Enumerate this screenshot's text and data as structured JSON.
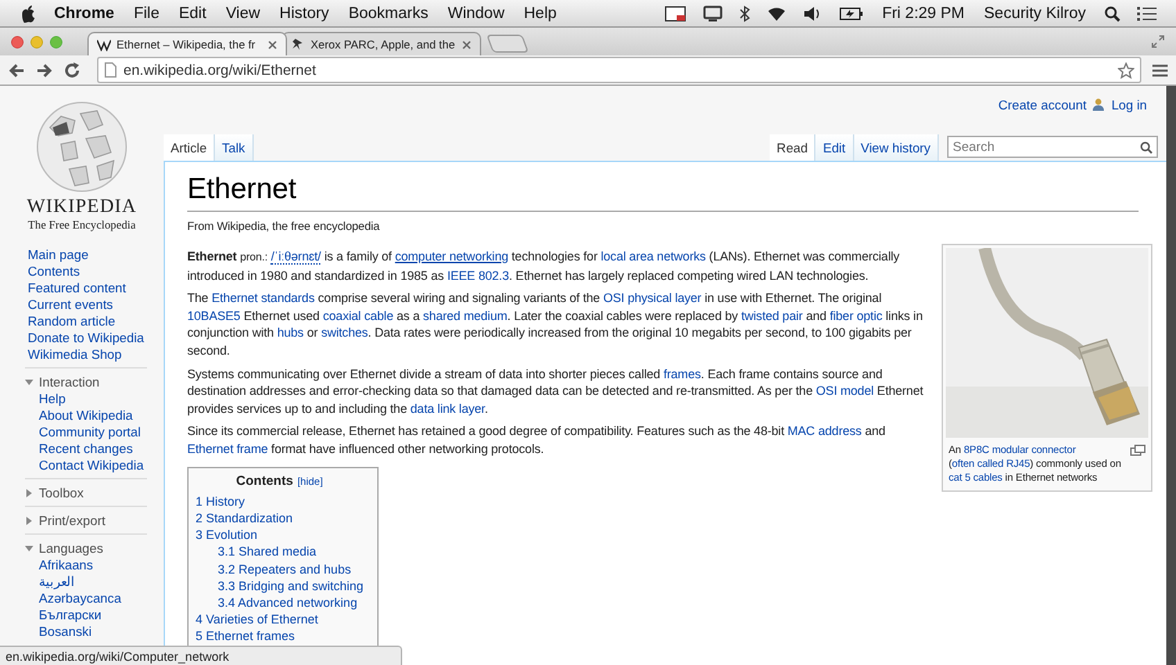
{
  "menubar": {
    "app": "Chrome",
    "menus": [
      "File",
      "Edit",
      "View",
      "History",
      "Bookmarks",
      "Window",
      "Help"
    ],
    "clock": "Fri 2:29 PM",
    "user": "Security Kilroy"
  },
  "browser": {
    "tabs": [
      {
        "title": "Ethernet – Wikipedia, the fr",
        "selected": true
      },
      {
        "title": "Xerox PARC, Apple, and the",
        "selected": false
      }
    ],
    "address": "en.wikipedia.org/wiki/Ethernet"
  },
  "wiki": {
    "logo": {
      "wordmark": "WIKIPEDIA",
      "tagline": "The Free Encyclopedia"
    },
    "nav": [
      "Main page",
      "Contents",
      "Featured content",
      "Current events",
      "Random article",
      "Donate to Wikipedia",
      "Wikimedia Shop"
    ],
    "portlets": [
      {
        "title": "Interaction",
        "expanded": true,
        "items": [
          "Help",
          "About Wikipedia",
          "Community portal",
          "Recent changes",
          "Contact Wikipedia"
        ]
      },
      {
        "title": "Toolbox",
        "expanded": false
      },
      {
        "title": "Print/export",
        "expanded": false
      },
      {
        "title": "Languages",
        "expanded": true,
        "items": [
          "Afrikaans",
          "العربية",
          "Azərbaycanca",
          "Български",
          "Bosanski"
        ]
      }
    ],
    "personal": [
      "Create account",
      "Log in"
    ],
    "namespaces": [
      {
        "label": "Article",
        "selected": true
      },
      {
        "label": "Talk",
        "selected": false
      }
    ],
    "views": [
      {
        "label": "Read",
        "selected": true
      },
      {
        "label": "Edit",
        "selected": false
      },
      {
        "label": "View history",
        "selected": false
      }
    ],
    "search": {
      "placeholder": "Search"
    },
    "article": {
      "title": "Ethernet",
      "tagline": "From Wikipedia, the free encyclopedia",
      "paragraphs": [
        [
          {
            "kind": "bold",
            "text": "Ethernet"
          },
          {
            "kind": "small",
            "text": "pron.:"
          },
          {
            "kind": "ipa",
            "text": "/ˈiːθərnɛt/"
          },
          {
            "kind": "text",
            "text": " is a family of "
          },
          {
            "kind": "hovered",
            "text": "computer networking"
          },
          {
            "kind": "text",
            "text": " technologies for "
          },
          {
            "kind": "link",
            "text": "local area networks"
          },
          {
            "kind": "text",
            "text": " (LANs). Ethernet was commercially introduced in 1980 and standardized in 1985 as "
          },
          {
            "kind": "link",
            "text": "IEEE 802.3"
          },
          {
            "kind": "text",
            "text": ". Ethernet has largely replaced competing wired LAN technologies."
          }
        ],
        [
          {
            "kind": "text",
            "text": "The "
          },
          {
            "kind": "link",
            "text": "Ethernet standards"
          },
          {
            "kind": "text",
            "text": " comprise several wiring and signaling variants of the "
          },
          {
            "kind": "link",
            "text": "OSI physical layer"
          },
          {
            "kind": "text",
            "text": " in use with Ethernet. The original "
          },
          {
            "kind": "link",
            "text": "10BASE5"
          },
          {
            "kind": "text",
            "text": " Ethernet used "
          },
          {
            "kind": "link",
            "text": "coaxial cable"
          },
          {
            "kind": "text",
            "text": " as a "
          },
          {
            "kind": "link",
            "text": "shared medium"
          },
          {
            "kind": "text",
            "text": ". Later the coaxial cables were replaced by "
          },
          {
            "kind": "link",
            "text": "twisted pair"
          },
          {
            "kind": "text",
            "text": " and "
          },
          {
            "kind": "link",
            "text": "fiber optic"
          },
          {
            "kind": "text",
            "text": " links in conjunction with "
          },
          {
            "kind": "link",
            "text": "hubs"
          },
          {
            "kind": "text",
            "text": " or "
          },
          {
            "kind": "link",
            "text": "switches"
          },
          {
            "kind": "text",
            "text": ". Data rates were periodically increased from the original 10 megabits per second, to 100 gigabits per second."
          }
        ],
        [
          {
            "kind": "text",
            "text": "Systems communicating over Ethernet divide a stream of data into shorter pieces called "
          },
          {
            "kind": "link",
            "text": "frames"
          },
          {
            "kind": "text",
            "text": ". Each frame contains source and destination addresses and error-checking data so that damaged data can be detected and re-transmitted. As per the "
          },
          {
            "kind": "link",
            "text": "OSI model"
          },
          {
            "kind": "text",
            "text": " Ethernet provides services up to and including the "
          },
          {
            "kind": "link",
            "text": "data link layer"
          },
          {
            "kind": "text",
            "text": "."
          }
        ],
        [
          {
            "kind": "text",
            "text": "Since its commercial release, Ethernet has retained a good degree of compatibility. Features such as the 48-bit "
          },
          {
            "kind": "link",
            "text": "MAC address"
          },
          {
            "kind": "text",
            "text": " and "
          },
          {
            "kind": "link",
            "text": "Ethernet frame"
          },
          {
            "kind": "text",
            "text": " format have influenced other networking protocols."
          }
        ]
      ]
    },
    "figure": {
      "kind": "picture",
      "caption": [
        {
          "kind": "text",
          "text": "An "
        },
        {
          "kind": "link",
          "text": "8P8C modular connector"
        },
        {
          "kind": "text",
          "text": " ("
        },
        {
          "kind": "link",
          "text": "often called"
        },
        {
          "kind": "link",
          "text": "RJ45"
        },
        {
          "kind": "text",
          "text": ") commonly used on "
        },
        {
          "kind": "link",
          "text": "cat 5 cables"
        },
        {
          "kind": "text",
          "text": " in Ethernet networks"
        }
      ]
    },
    "toc": {
      "title": "Contents",
      "toggle": "[hide]",
      "items": [
        {
          "label": "1 History"
        },
        {
          "label": "2 Standardization"
        },
        {
          "label": "3 Evolution",
          "children": [
            {
              "label": "3.1 Shared media"
            },
            {
              "label": "3.2 Repeaters and hubs"
            },
            {
              "label": "3.3 Bridging and switching"
            },
            {
              "label": "3.4 Advanced networking"
            }
          ]
        },
        {
          "label": "4 Varieties of Ethernet"
        },
        {
          "label": "5 Ethernet frames"
        }
      ]
    }
  },
  "status_bar": "en.wikipedia.org/wiki/Computer_network"
}
